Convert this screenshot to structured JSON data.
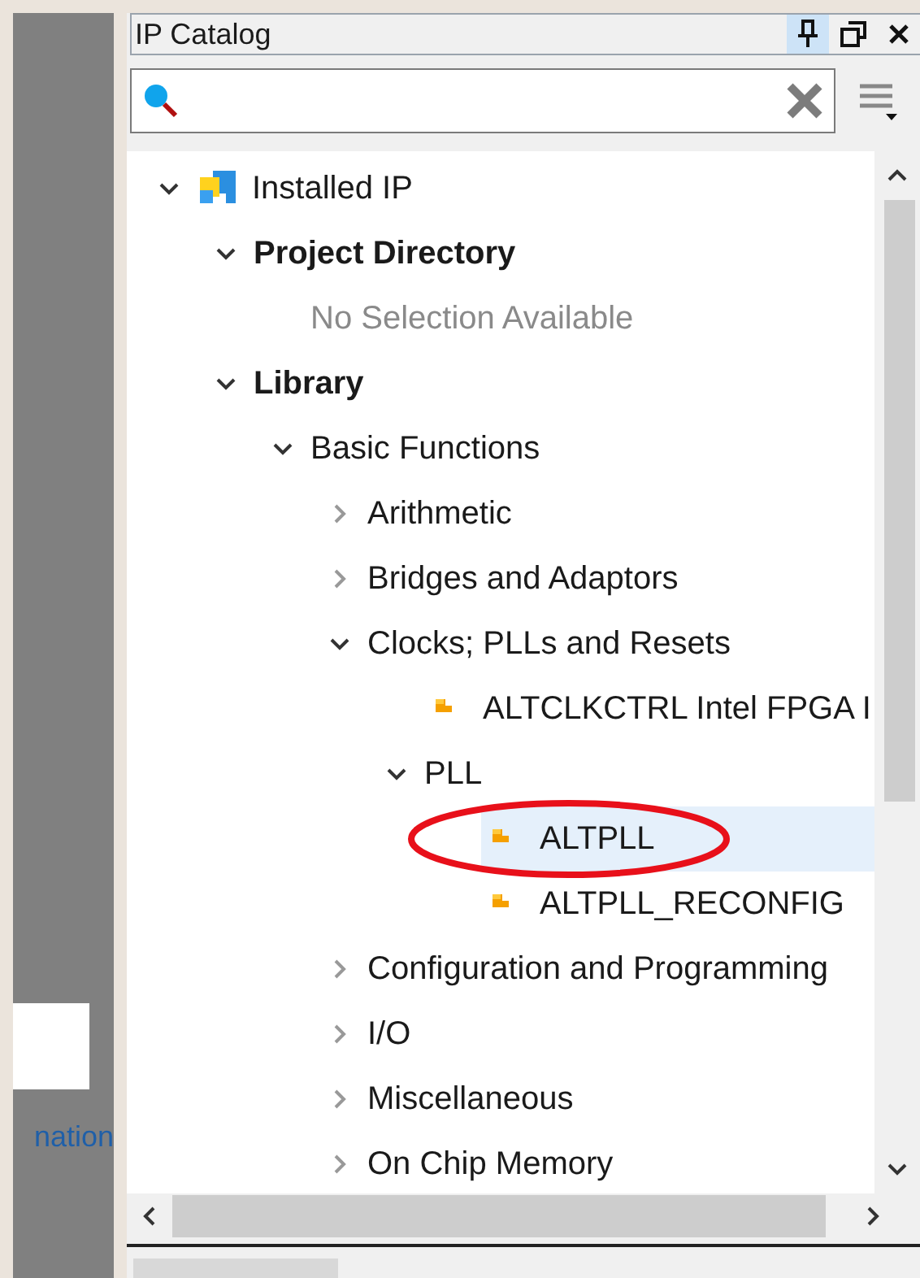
{
  "left_panel": {
    "link": "nation"
  },
  "panel": {
    "title": "IP Catalog",
    "pinned": true
  },
  "tree": [
    {
      "label": "Installed IP",
      "kind": "root",
      "expanded": true,
      "children": [
        {
          "label": "Project Directory",
          "kind": "folder",
          "expanded": true,
          "children": [
            {
              "label": "No Selection Available",
              "kind": "empty"
            }
          ]
        },
        {
          "label": "Library",
          "kind": "folder",
          "expanded": true,
          "children": [
            {
              "label": "Basic Functions",
              "kind": "category",
              "expanded": true,
              "children": [
                {
                  "label": "Arithmetic",
                  "kind": "category",
                  "expanded": false
                },
                {
                  "label": "Bridges and Adaptors",
                  "kind": "category",
                  "expanded": false
                },
                {
                  "label": "Clocks; PLLs and Resets",
                  "kind": "category",
                  "expanded": true,
                  "children": [
                    {
                      "label": "ALTCLKCTRL Intel FPGA I",
                      "kind": "ip",
                      "selected": false,
                      "circled": false
                    },
                    {
                      "label": "PLL",
                      "kind": "category",
                      "expanded": true,
                      "children": [
                        {
                          "label": "ALTPLL",
                          "kind": "ip",
                          "selected": true,
                          "circled": true
                        },
                        {
                          "label": "ALTPLL_RECONFIG",
                          "kind": "ip",
                          "selected": false,
                          "circled": false
                        }
                      ]
                    }
                  ]
                },
                {
                  "label": "Configuration and Programming",
                  "kind": "category",
                  "expanded": false
                },
                {
                  "label": "I/O",
                  "kind": "category",
                  "expanded": false
                },
                {
                  "label": "Miscellaneous",
                  "kind": "category",
                  "expanded": false
                },
                {
                  "label": "On Chip Memory",
                  "kind": "category",
                  "expanded": false
                }
              ]
            }
          ]
        }
      ]
    }
  ]
}
